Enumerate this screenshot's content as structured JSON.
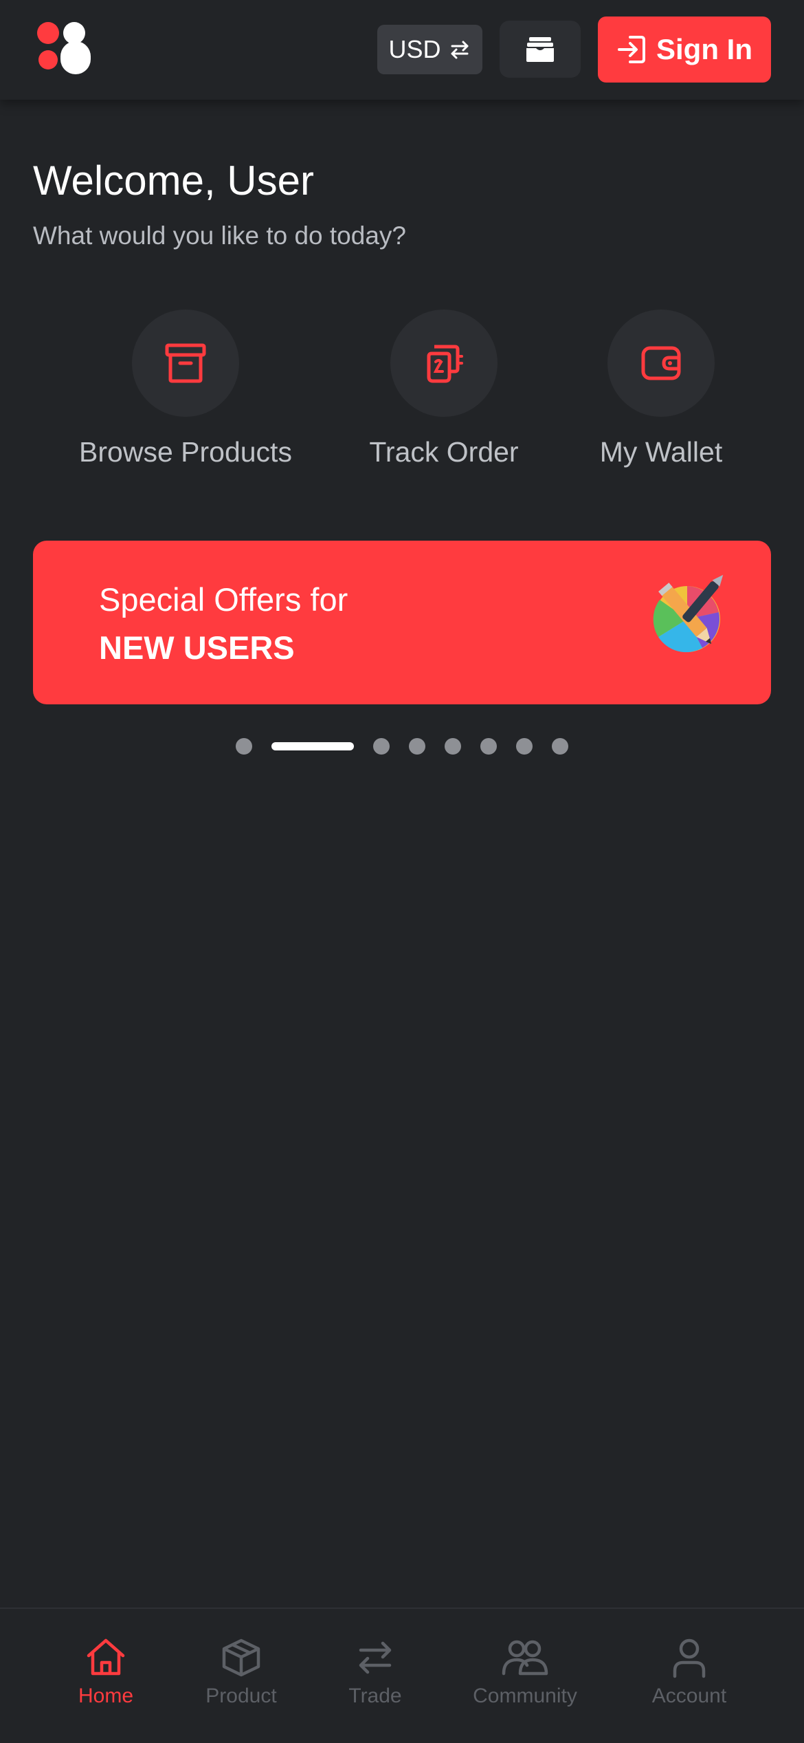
{
  "header": {
    "currency_label": "USD",
    "signin_label": "Sign In"
  },
  "welcome": {
    "title": "Welcome, User",
    "subtitle": "What would you like to do today?"
  },
  "actions": [
    {
      "label": "Browse Products",
      "icon": "archive-box-icon"
    },
    {
      "label": "Track Order",
      "icon": "receipt-icon"
    },
    {
      "label": "My Wallet",
      "icon": "wallet-icon"
    }
  ],
  "banner": {
    "line1": "Special Offers for",
    "line2": "NEW USERS"
  },
  "carousel": {
    "total": 8,
    "active_index": 1
  },
  "bottom_nav": [
    {
      "label": "Home",
      "icon": "home-icon",
      "active": true
    },
    {
      "label": "Product",
      "icon": "box-icon",
      "active": false
    },
    {
      "label": "Trade",
      "icon": "swap-arrows-icon",
      "active": false
    },
    {
      "label": "Community",
      "icon": "people-icon",
      "active": false
    },
    {
      "label": "Account",
      "icon": "person-icon",
      "active": false
    }
  ],
  "colors": {
    "background": "#222427",
    "accent": "#ff3b3f",
    "muted": "#5d6066"
  }
}
